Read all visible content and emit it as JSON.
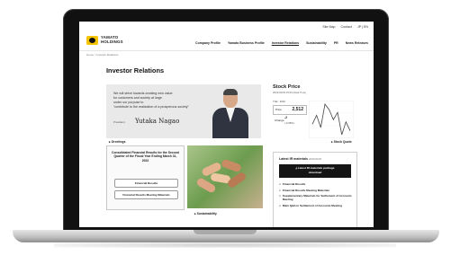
{
  "topbar": {
    "site_map": "Site Map",
    "contact": "Contact",
    "lang": "JP | EN"
  },
  "brand": {
    "line1": "YAMATO",
    "line2": "HOLDINGS"
  },
  "nav": [
    "Company Profile",
    "Yamato Business Profile",
    "Investor Relations",
    "Sustainability",
    "PR",
    "News Releases"
  ],
  "breadcrumb": "Home > Investor Relations",
  "page_title": "Investor Relations",
  "message": {
    "lines": [
      "We will strive towards creating new value",
      "for customers and society at large",
      "under our purpose to",
      "“contribute to the realization of a prosperous society”"
    ],
    "president_label": "President",
    "president_name": "Yutaka Nagao"
  },
  "links": {
    "greetings": "Greetings",
    "stock_quote": "Stock Quote",
    "sustainability": "Sustainability"
  },
  "stock": {
    "title": "Stock Price",
    "updated": "2022/03/03 15:00 (Real Time)",
    "code_label": "TSE : 9064",
    "price_label": "Price",
    "price": "2,512",
    "change_label": "Change",
    "change": "-2",
    "change_pct": "(-0.08%)",
    "chart_points": [
      2524,
      2540,
      2518,
      2560,
      2550,
      2532,
      2545,
      2505,
      2528,
      2512
    ]
  },
  "results": {
    "title": "Consolidated Financial Results for the Second Quarter of the Fiscal Year Ending March 31, 2022",
    "btn1": "Financial Results",
    "btn2": "Financial Results Meeting Materials"
  },
  "ir": {
    "title": "Latest IR materials",
    "date": "2022/02/03",
    "download_line1": "Latest IR materials package",
    "download_line2": "download",
    "items": [
      "Financial Results",
      "Financial Results Meeting Materials",
      "Supplementary Materials for Settlement of Accounts Meeting",
      "Main Q&A in Settlement of Accounts Meeting"
    ]
  },
  "colors": {
    "brand_yellow": "#f5c400",
    "dark": "#151515",
    "hero_bg": "#e9e9e9"
  }
}
